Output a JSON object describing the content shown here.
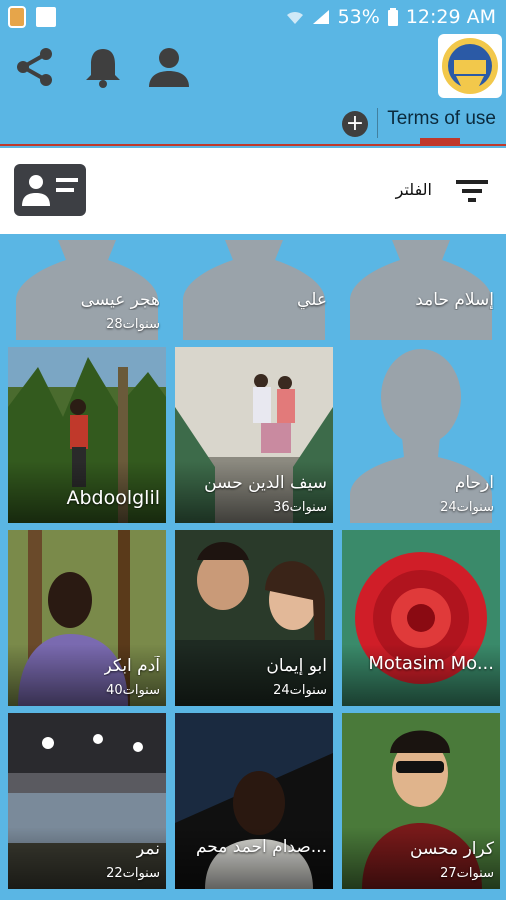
{
  "status_bar": {
    "battery_percent": "53%",
    "time": "12:29 AM"
  },
  "appbar": {
    "share_icon": "share-icon",
    "bell_icon": "bell-icon",
    "person_icon": "person-icon"
  },
  "termsbar": {
    "terms_label": "Terms of use",
    "plus_label": "+"
  },
  "filterbar": {
    "filter_label": "الفلتر"
  },
  "colors": {
    "brand_blue": "#5ab6e4",
    "accent_red": "#c0392b",
    "placeholder_gray": "#9aa3aa"
  },
  "profiles": [
    {
      "name": "هجر عيسى",
      "age": "28سنوات"
    },
    {
      "name": "علي",
      "age": ""
    },
    {
      "name": "إسلام حامد",
      "age": ""
    },
    {
      "name": "Abdoolglil",
      "age": ""
    },
    {
      "name": "سيف الدين حسن",
      "age": "36سنوات"
    },
    {
      "name": "ارحام",
      "age": "24سنوات"
    },
    {
      "name": "آدم ابكر",
      "age": "40سنوات"
    },
    {
      "name": "ابو إيمان",
      "age": "24سنوات"
    },
    {
      "name": "Motasim Mo...",
      "age": ""
    },
    {
      "name": "نمر",
      "age": "22سنوات"
    },
    {
      "name": "صدام احمد محم...",
      "age": ""
    },
    {
      "name": "كرار محسن",
      "age": "27سنوات"
    }
  ]
}
